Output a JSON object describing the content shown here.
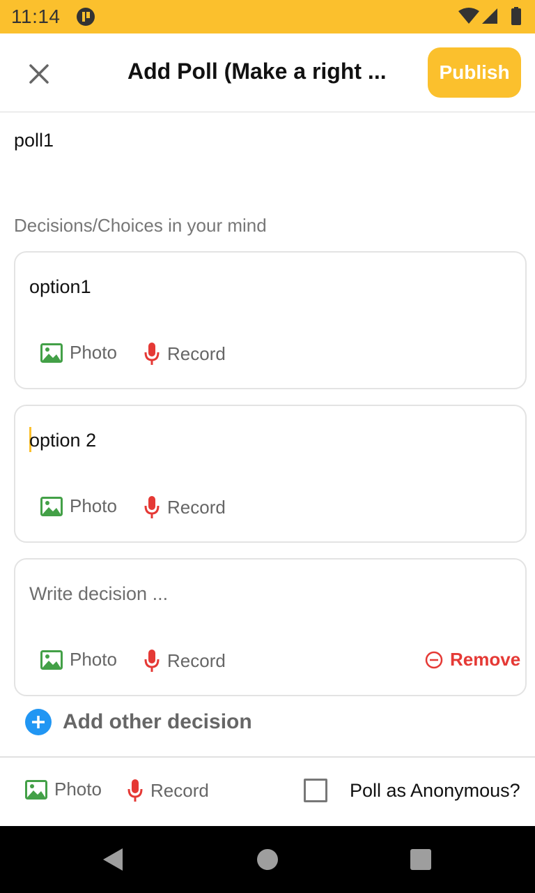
{
  "status_bar": {
    "time": "11:14"
  },
  "app_bar": {
    "title": "Add Poll (Make a right ...",
    "publish_label": "Publish"
  },
  "poll": {
    "title": "poll1"
  },
  "section_label": "Decisions/Choices in your mind",
  "options": [
    {
      "text": "option1",
      "photo_label": "Photo",
      "record_label": "Record"
    },
    {
      "text": "option 2",
      "photo_label": "Photo",
      "record_label": "Record"
    },
    {
      "placeholder": "Write decision ...",
      "photo_label": "Photo",
      "record_label": "Record",
      "remove_label": "Remove"
    }
  ],
  "add_decision_label": "Add other decision",
  "bottom_bar": {
    "photo_label": "Photo",
    "record_label": "Record",
    "anonymous_label": "Poll as Anonymous?",
    "anonymous_checked": false
  },
  "colors": {
    "accent": "#FBC02D",
    "photo_icon": "#43A047",
    "mic_icon": "#E53935",
    "add_icon": "#2196F3",
    "remove": "#E53935"
  }
}
